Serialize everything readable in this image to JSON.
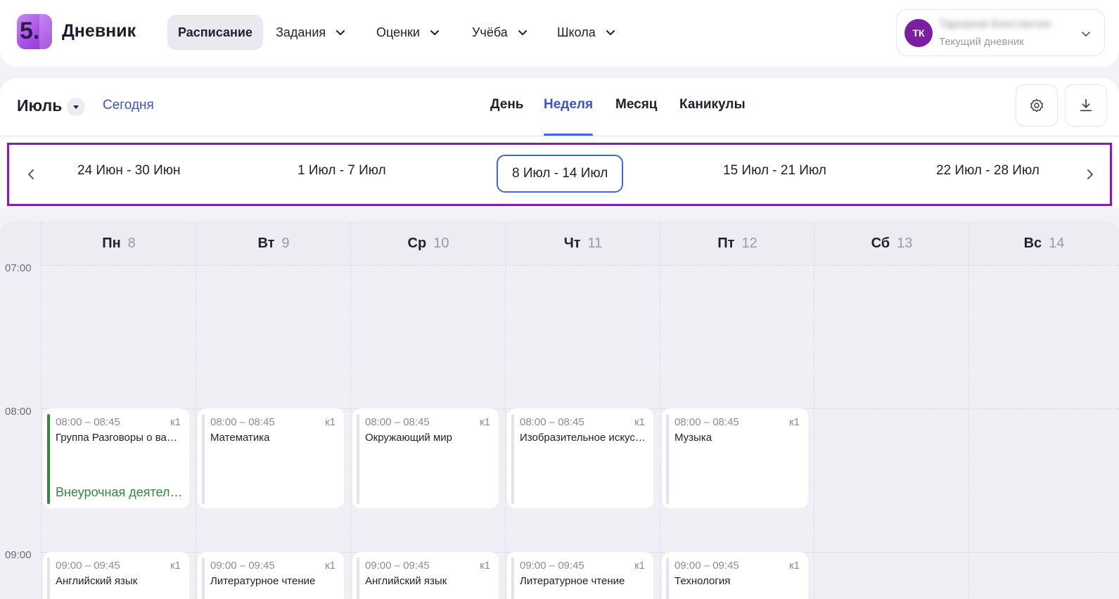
{
  "app": {
    "logo_text": "5.",
    "brand": "Дневник"
  },
  "nav": {
    "items": [
      {
        "label": "Расписание"
      },
      {
        "label": "Задания"
      },
      {
        "label": "Оценки"
      },
      {
        "label": "Учёба"
      },
      {
        "label": "Школа"
      }
    ]
  },
  "profile": {
    "initials": "ТК",
    "name": "Тарханов Константин",
    "subtitle": "Текущий дневник"
  },
  "controls": {
    "month": "Июль",
    "today": "Сегодня",
    "tabs": [
      {
        "label": "День"
      },
      {
        "label": "Неделя"
      },
      {
        "label": "Месяц"
      },
      {
        "label": "Каникулы"
      }
    ]
  },
  "weeks": [
    {
      "label": "24 Июн - 30 Июн"
    },
    {
      "label": "1 Июл - 7 Июл"
    },
    {
      "label": "8 Июл - 14 Июл"
    },
    {
      "label": "15 Июл - 21 Июл"
    },
    {
      "label": "22 Июл - 28 Июл"
    }
  ],
  "days": [
    {
      "name": "Пн",
      "num": "8"
    },
    {
      "name": "Вт",
      "num": "9"
    },
    {
      "name": "Ср",
      "num": "10"
    },
    {
      "name": "Чт",
      "num": "11"
    },
    {
      "name": "Пт",
      "num": "12"
    },
    {
      "name": "Сб",
      "num": "13"
    },
    {
      "name": "Вс",
      "num": "14"
    }
  ],
  "times": [
    "07:00",
    "08:00",
    "09:00"
  ],
  "lessons": {
    "slot_0800": [
      {
        "time": "08:00 – 08:45",
        "room": "к1",
        "subject": "Группа Разговоры о важном",
        "tag": "Внеурочная деятельность"
      },
      {
        "time": "08:00 – 08:45",
        "room": "к1",
        "subject": "Математика"
      },
      {
        "time": "08:00 – 08:45",
        "room": "к1",
        "subject": "Окружающий мир"
      },
      {
        "time": "08:00 – 08:45",
        "room": "к1",
        "subject": "Изобразительное искусство"
      },
      {
        "time": "08:00 – 08:45",
        "room": "к1",
        "subject": "Музыка"
      }
    ],
    "slot_0900": [
      {
        "time": "09:00 – 09:45",
        "room": "к1",
        "subject": "Английский язык"
      },
      {
        "time": "09:00 – 09:45",
        "room": "к1",
        "subject": "Литературное чтение"
      },
      {
        "time": "09:00 – 09:45",
        "room": "к1",
        "subject": "Английский язык"
      },
      {
        "time": "09:00 – 09:45",
        "room": "к1",
        "subject": "Литературное чтение"
      },
      {
        "time": "09:00 – 09:45",
        "room": "к1",
        "subject": "Технология"
      }
    ]
  },
  "colors": {
    "accent": "#3b53c9",
    "highlight_border": "#8a1bb0",
    "extracurricular": "#2e8b3e",
    "avatar": "#7a1fa2"
  }
}
